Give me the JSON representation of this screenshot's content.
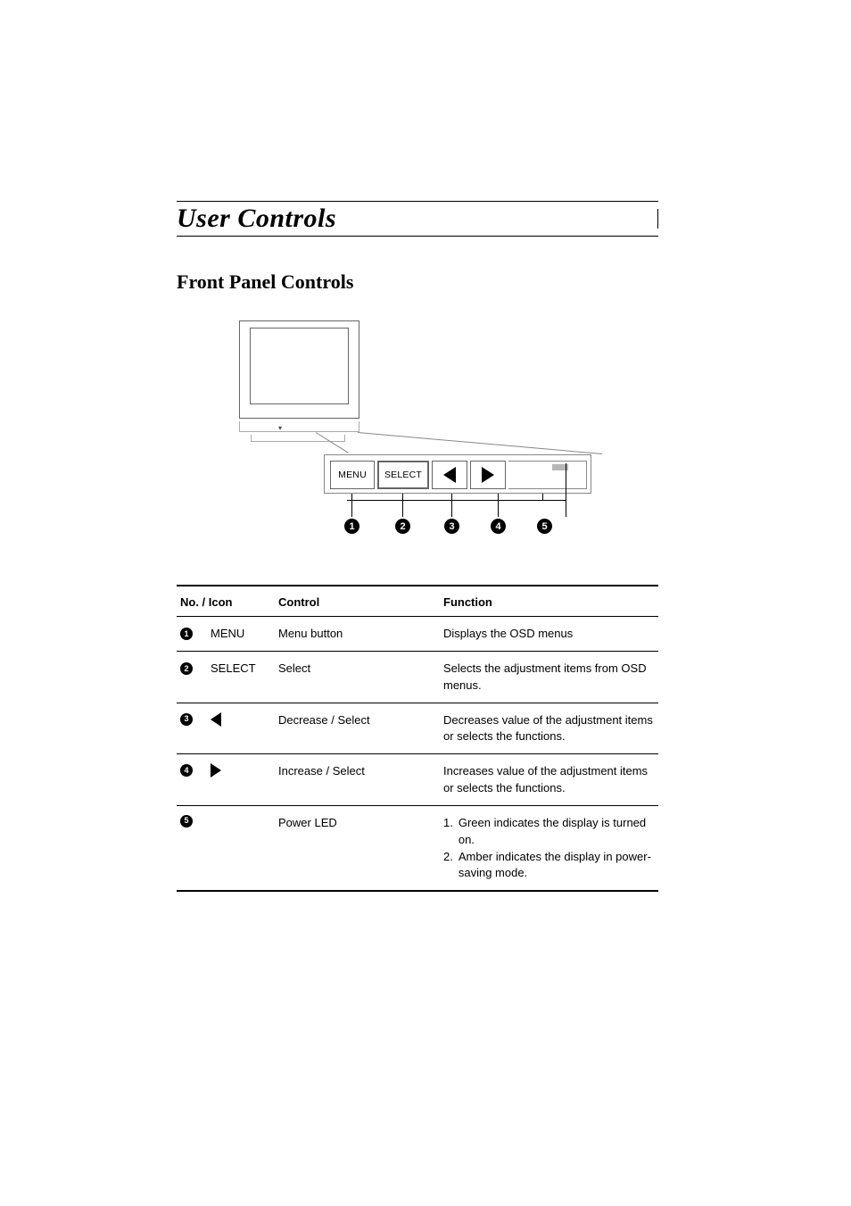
{
  "headings": {
    "main": "User Controls",
    "sub": "Front Panel Controls"
  },
  "diagram": {
    "buttons": {
      "menu": "MENU",
      "select": "SELECT"
    },
    "callouts": [
      "1",
      "2",
      "3",
      "4",
      "5"
    ]
  },
  "table": {
    "headers": {
      "no": "No. / Icon",
      "control": "Control",
      "function": "Function"
    },
    "rows": [
      {
        "num": "1",
        "icon_text": "MENU",
        "control": "Menu button",
        "function": "Displays the OSD menus"
      },
      {
        "num": "2",
        "icon_text": "SELECT",
        "control": "Select",
        "function": "Selects the adjustment items from OSD menus."
      },
      {
        "num": "3",
        "icon_type": "arrow-left",
        "control": "Decrease  / Select",
        "function": "Decreases value of the adjustment items or selects the functions."
      },
      {
        "num": "4",
        "icon_type": "arrow-right",
        "control": "Increase / Select",
        "function": "Increases value of the adjustment items or selects the functions."
      },
      {
        "num": "5",
        "control": "Power LED",
        "function_list": [
          {
            "n": "1.",
            "t": "Green indicates the display is turned on."
          },
          {
            "n": "2.",
            "t": "Amber indicates the display in power-saving mode."
          }
        ]
      }
    ]
  }
}
